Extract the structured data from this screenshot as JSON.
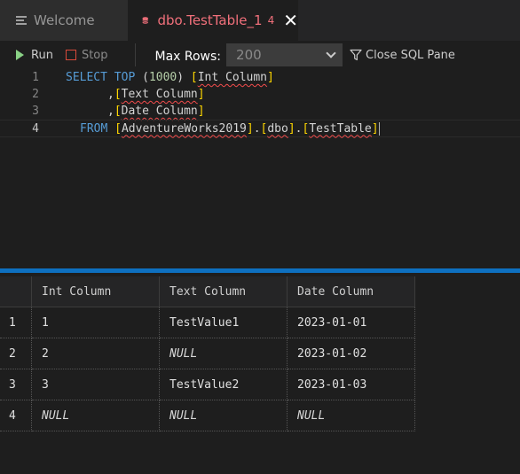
{
  "tabs": [
    {
      "label": "Welcome"
    },
    {
      "label": "dbo.TestTable_1",
      "problem_count": "4"
    }
  ],
  "toolbar": {
    "run_label": "Run",
    "stop_label": "Stop",
    "max_rows_label": "Max Rows:",
    "max_rows_value": "200",
    "close_sql_label": "Close SQL Pane"
  },
  "editor": {
    "line_numbers": [
      "1",
      "2",
      "3",
      "4"
    ],
    "line1": {
      "kw1": "SELECT",
      "kw2": "TOP",
      "lp": "(",
      "num": "1000",
      "rp": ")",
      "lb": "[",
      "id": "Int Column",
      "rb": "]"
    },
    "line2": {
      "comma": ",",
      "lb": "[",
      "id": "Text Column",
      "rb": "]"
    },
    "line3": {
      "comma": ",",
      "lb": "[",
      "id": "Date Column",
      "rb": "]"
    },
    "line4": {
      "kw": "FROM",
      "lb1": "[",
      "id1": "AdventureWorks2019",
      "rb1": "]",
      "dot1": ".",
      "lb2": "[",
      "id2": "dbo",
      "rb2": "]",
      "dot2": ".",
      "lb3": "[",
      "id3": "TestTable",
      "rb3": "]"
    }
  },
  "grid": {
    "columns": [
      "",
      "Int Column",
      "Text Column",
      "Date Column"
    ],
    "rows": [
      [
        "1",
        "1",
        "TestValue1",
        "2023-01-01"
      ],
      [
        "2",
        "2",
        "NULL",
        "2023-01-02"
      ],
      [
        "3",
        "3",
        "TestValue2",
        "2023-01-03"
      ],
      [
        "4",
        "NULL",
        "NULL",
        "NULL"
      ]
    ]
  },
  "colors": {
    "accent": "#0e70c0",
    "tab_title": "#f1707b",
    "run_icon": "#89d185",
    "stop_icon": "#d84a3a",
    "keyword": "#569cd6",
    "number": "#b5cea8",
    "bracket": "#ffd700"
  },
  "icons": {
    "welcome_tab": "menu-icon",
    "table_tab": "database-icon",
    "run": "play-icon",
    "stop": "stop-icon",
    "max_rows": "chevron-down-icon",
    "close_sql": "funnel-icon"
  }
}
